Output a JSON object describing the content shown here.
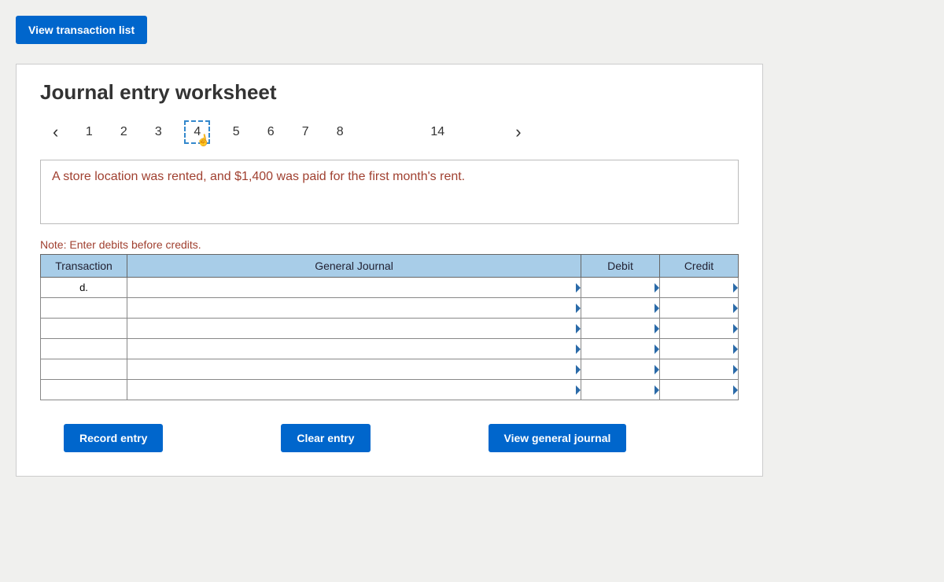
{
  "top_button": "View transaction list",
  "title": "Journal entry worksheet",
  "pager": {
    "prev": "‹",
    "next": "›",
    "pages": [
      "1",
      "2",
      "3",
      "4",
      "5",
      "6",
      "7",
      "8",
      "14"
    ],
    "active_index": 3
  },
  "description": "A store location was rented, and $1,400 was paid for the first month's rent.",
  "note": "Note: Enter debits before credits.",
  "table": {
    "headers": {
      "transaction": "Transaction",
      "general_journal": "General Journal",
      "debit": "Debit",
      "credit": "Credit"
    },
    "rows": [
      {
        "transaction": "d.",
        "gj": "",
        "debit": "",
        "credit": ""
      },
      {
        "transaction": "",
        "gj": "",
        "debit": "",
        "credit": ""
      },
      {
        "transaction": "",
        "gj": "",
        "debit": "",
        "credit": ""
      },
      {
        "transaction": "",
        "gj": "",
        "debit": "",
        "credit": ""
      },
      {
        "transaction": "",
        "gj": "",
        "debit": "",
        "credit": ""
      },
      {
        "transaction": "",
        "gj": "",
        "debit": "",
        "credit": ""
      }
    ]
  },
  "buttons": {
    "record": "Record entry",
    "clear": "Clear entry",
    "view_journal": "View general journal"
  }
}
